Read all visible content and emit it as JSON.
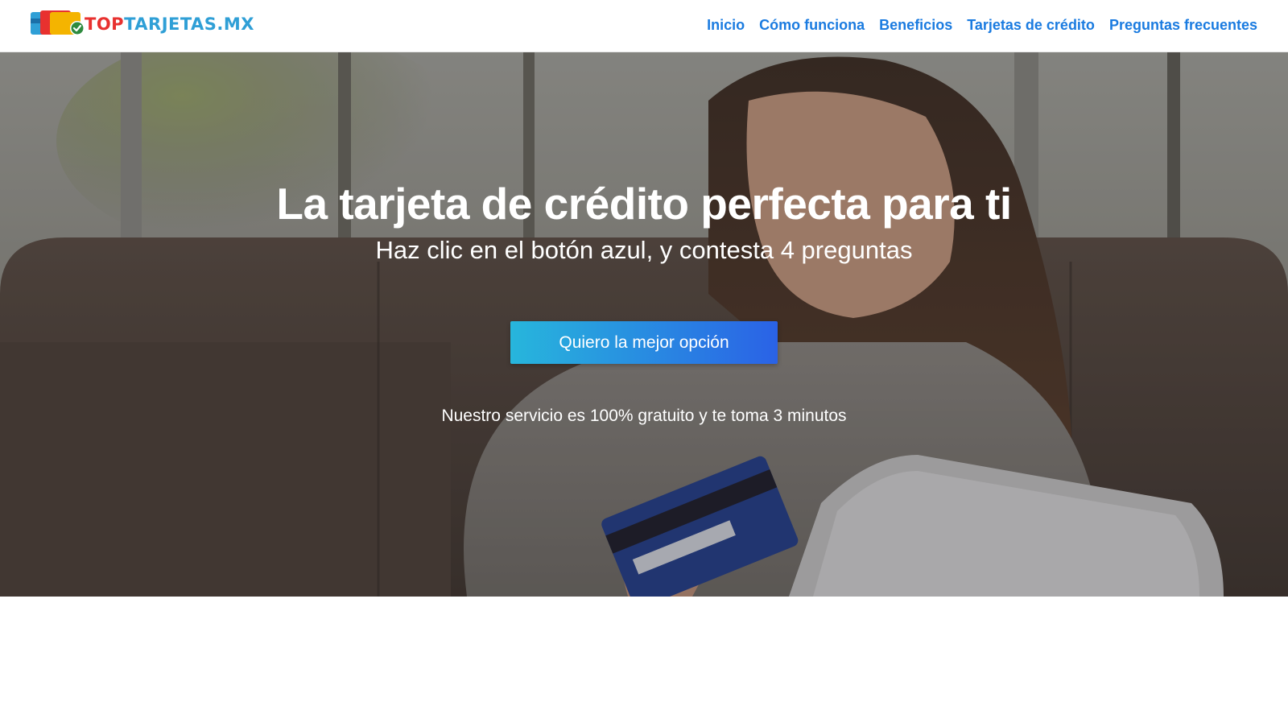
{
  "logo": {
    "top": "TOP",
    "rest": "TARJETAS.MX"
  },
  "nav": {
    "items": [
      {
        "label": "Inicio"
      },
      {
        "label": "Cómo funciona"
      },
      {
        "label": "Beneficios"
      },
      {
        "label": "Tarjetas de crédito"
      },
      {
        "label": "Preguntas frecuentes"
      }
    ]
  },
  "hero": {
    "title": "La tarjeta de crédito perfecta para ti",
    "subtitle": "Haz clic en el botón azul, y contesta 4 preguntas",
    "cta_label": "Quiero la mejor opción",
    "note": "Nuestro servicio es 100% gratuito y te toma 3 minutos",
    "image_icon": "woman-with-credit-card-photo"
  },
  "colors": {
    "nav_link": "#1a7be0",
    "logo_red": "#e8312f",
    "logo_blue": "#2f9fd6",
    "cta_start": "#27b6dc",
    "cta_end": "#2a62e6"
  }
}
